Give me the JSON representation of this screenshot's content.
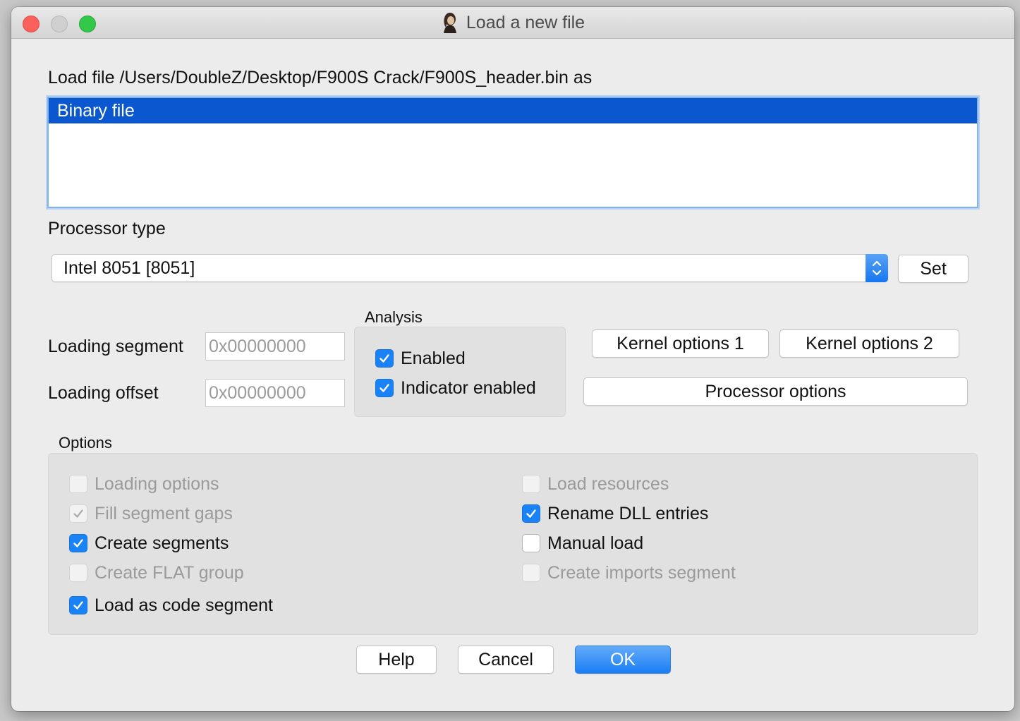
{
  "window": {
    "title": "Load a new file"
  },
  "load_file_label": "Load file /Users/DoubleZ/Desktop/F900S Crack/F900S_header.bin as",
  "file_types": [
    "Binary file"
  ],
  "processor": {
    "label": "Processor type",
    "selected": "Intel 8051 [8051]",
    "set_label": "Set"
  },
  "loading_segment": {
    "label": "Loading segment",
    "value": "0x00000000"
  },
  "loading_offset": {
    "label": "Loading offset",
    "value": "0x00000000"
  },
  "analysis": {
    "title": "Analysis",
    "enabled": {
      "label": "Enabled",
      "checked": true
    },
    "indicator": {
      "label": "Indicator enabled",
      "checked": true
    }
  },
  "kernel_options_1": "Kernel options 1",
  "kernel_options_2": "Kernel options 2",
  "processor_options": "Processor options",
  "options": {
    "title": "Options",
    "loading_options": {
      "label": "Loading options",
      "checked": false,
      "disabled": true
    },
    "fill_segment_gaps": {
      "label": "Fill segment gaps",
      "checked": true,
      "disabled": true
    },
    "create_segments": {
      "label": "Create segments",
      "checked": true,
      "disabled": false
    },
    "create_flat_group": {
      "label": "Create FLAT group",
      "checked": false,
      "disabled": true
    },
    "load_as_code_segment": {
      "label": "Load as code segment",
      "checked": true,
      "disabled": false
    },
    "load_resources": {
      "label": "Load resources",
      "checked": false,
      "disabled": true
    },
    "rename_dll_entries": {
      "label": "Rename DLL entries",
      "checked": true,
      "disabled": false
    },
    "manual_load": {
      "label": "Manual load",
      "checked": false,
      "disabled": false
    },
    "create_imports_segment": {
      "label": "Create imports segment",
      "checked": false,
      "disabled": true
    }
  },
  "buttons": {
    "help": "Help",
    "cancel": "Cancel",
    "ok": "OK"
  },
  "colors": {
    "accent": "#1a82f7",
    "selection": "#0b57d0"
  }
}
